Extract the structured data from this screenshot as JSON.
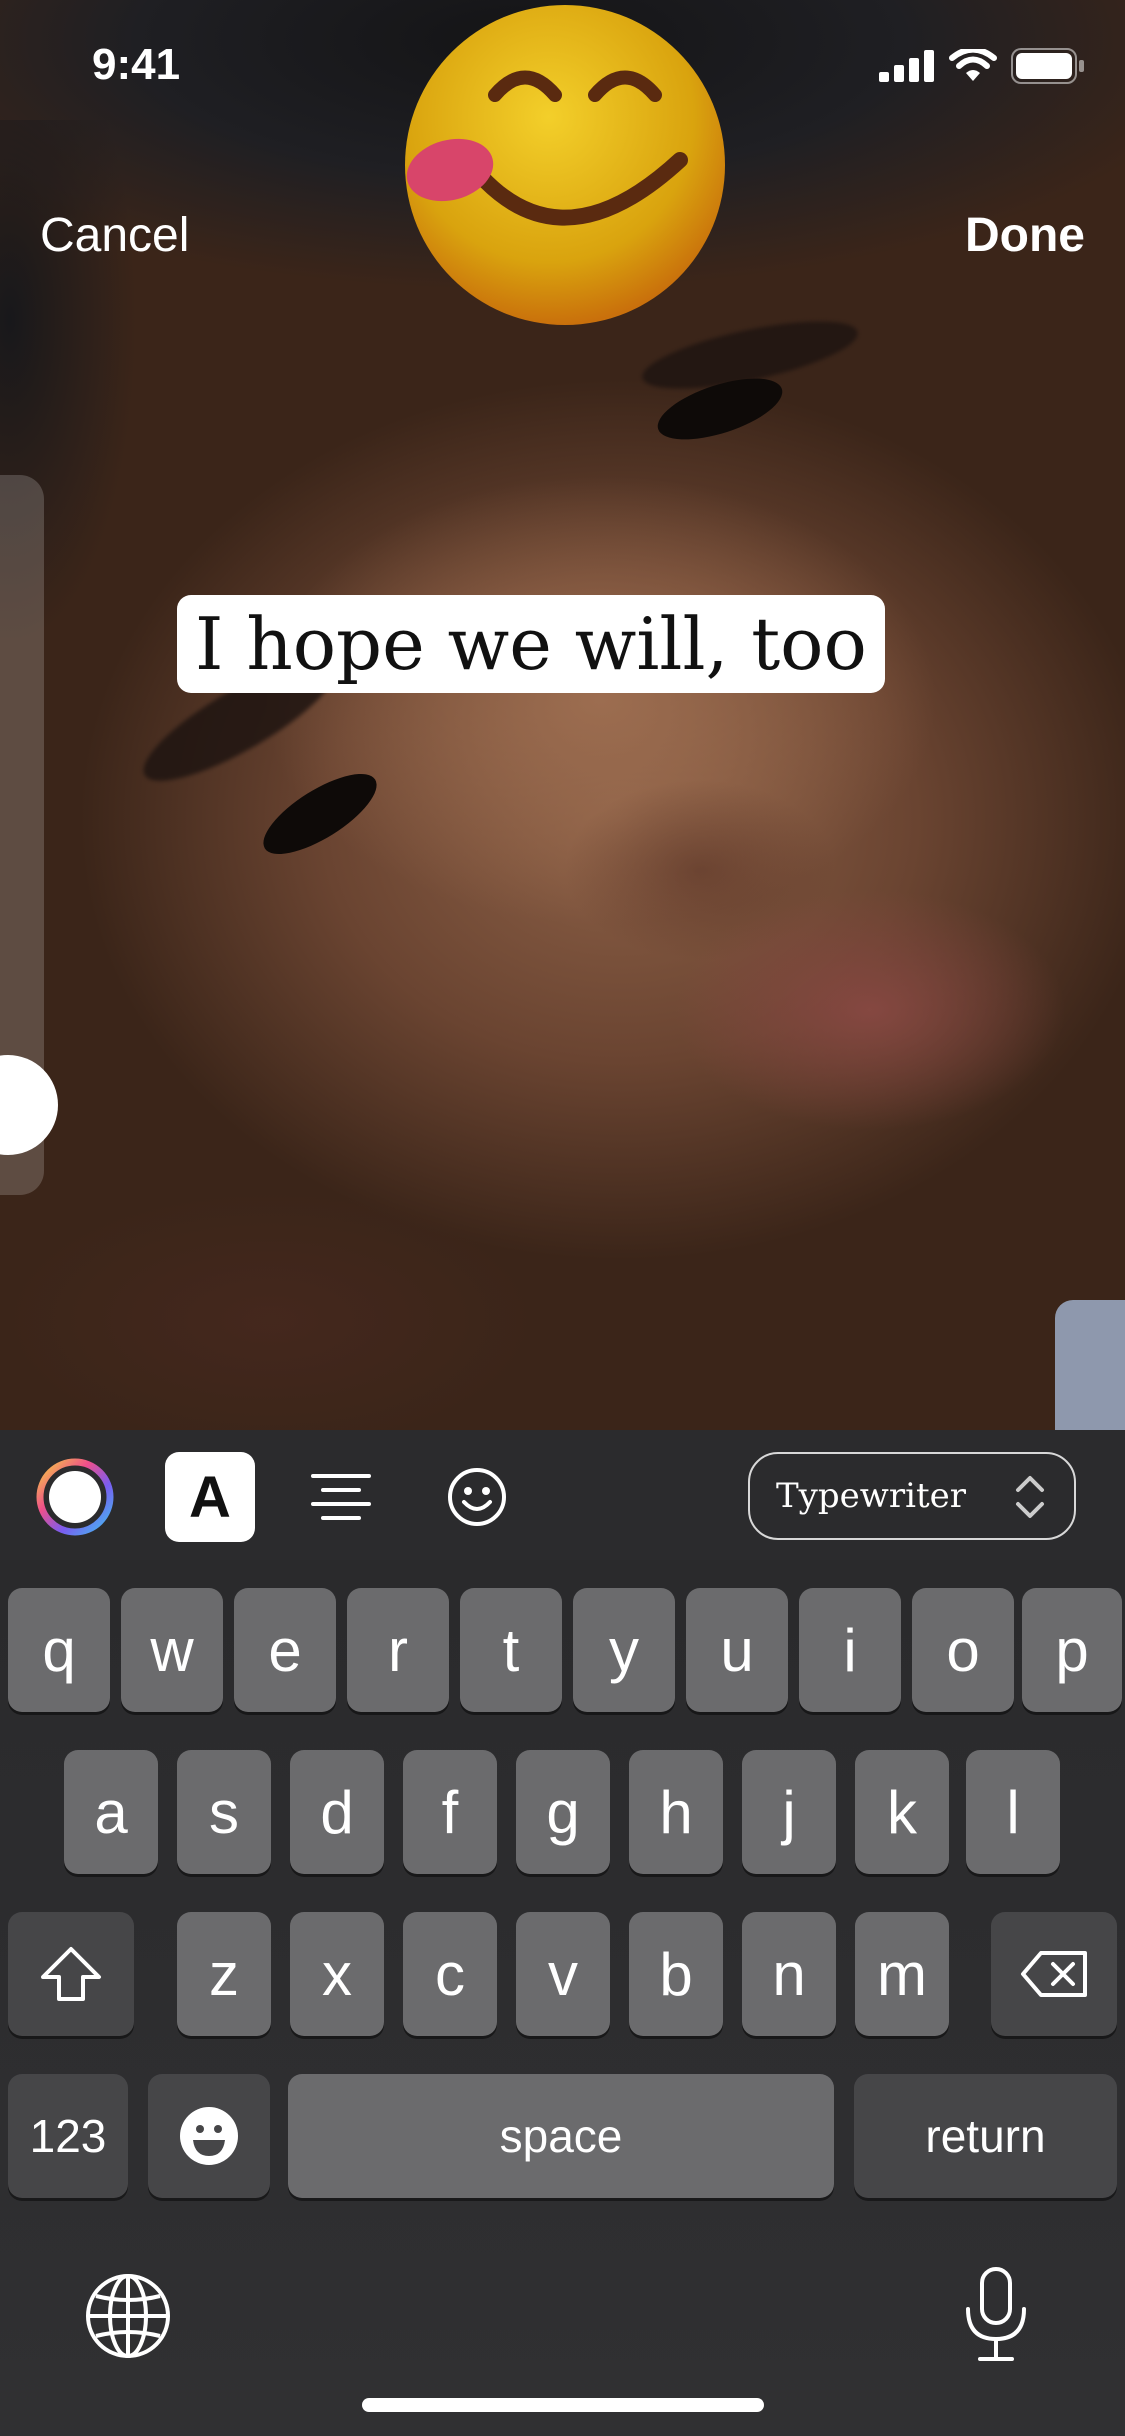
{
  "status_bar": {
    "time": "9:41"
  },
  "nav": {
    "cancel_label": "Cancel",
    "done_label": "Done"
  },
  "caption": {
    "text": "I hope we will, too"
  },
  "toolbar": {
    "font_style_label": "A",
    "font_name": "Typewriter"
  },
  "keyboard": {
    "row1": [
      "q",
      "w",
      "e",
      "r",
      "t",
      "y",
      "u",
      "i",
      "o",
      "p"
    ],
    "row2": [
      "a",
      "s",
      "d",
      "f",
      "g",
      "h",
      "j",
      "k",
      "l"
    ],
    "row3": [
      "z",
      "x",
      "c",
      "v",
      "b",
      "n",
      "m"
    ],
    "numbers_label": "123",
    "space_label": "space",
    "return_label": "return"
  },
  "colors": {
    "key_bg": "#6b6b6d",
    "key_dark_bg": "#464648",
    "toolbar_bg": "#2b2b2d"
  }
}
